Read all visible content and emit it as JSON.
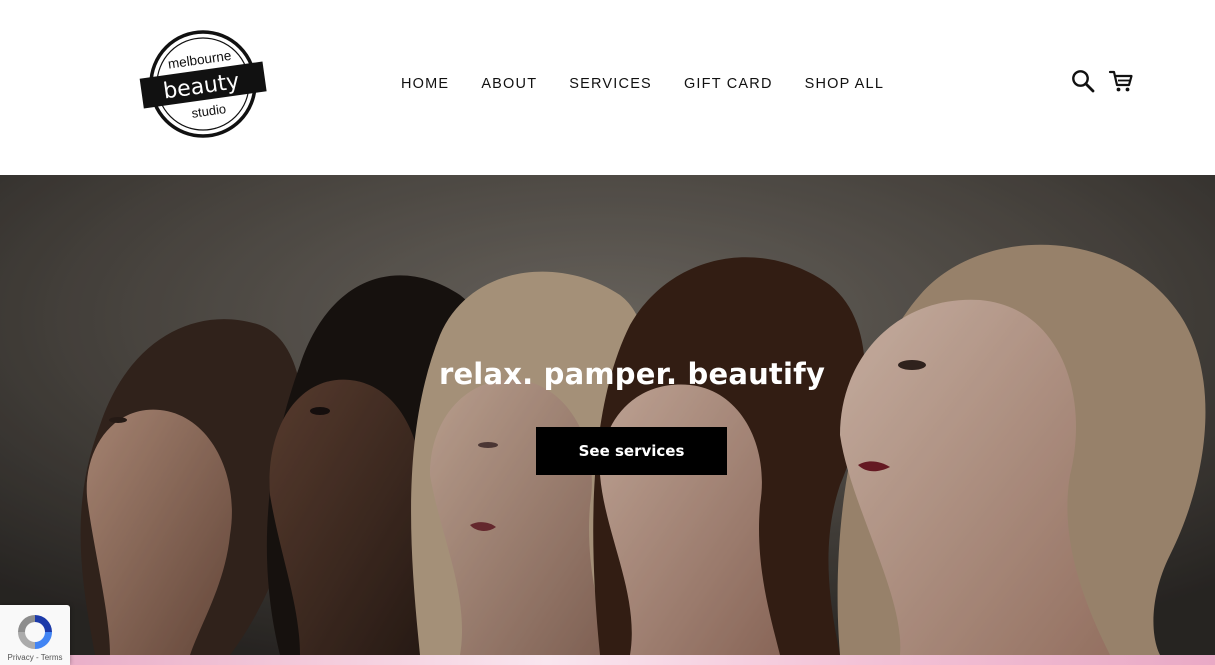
{
  "brand": {
    "line1": "melbourne",
    "line2": "beauty",
    "line3": "studio"
  },
  "nav": {
    "items": [
      {
        "label": "HOME"
      },
      {
        "label": "ABOUT"
      },
      {
        "label": "SERVICES"
      },
      {
        "label": "GIFT CARD"
      },
      {
        "label": "SHOP ALL"
      }
    ]
  },
  "header_icons": [
    "search-icon",
    "cart-icon"
  ],
  "hero": {
    "title": "relax. pamper. beautify",
    "button_label": "See services"
  },
  "recaptcha": {
    "privacy": "Privacy",
    "separator": " - ",
    "terms": "Terms"
  },
  "colors": {
    "button_bg": "#000000",
    "button_text": "#ffffff",
    "accent_pink": "#f3c3d7"
  }
}
